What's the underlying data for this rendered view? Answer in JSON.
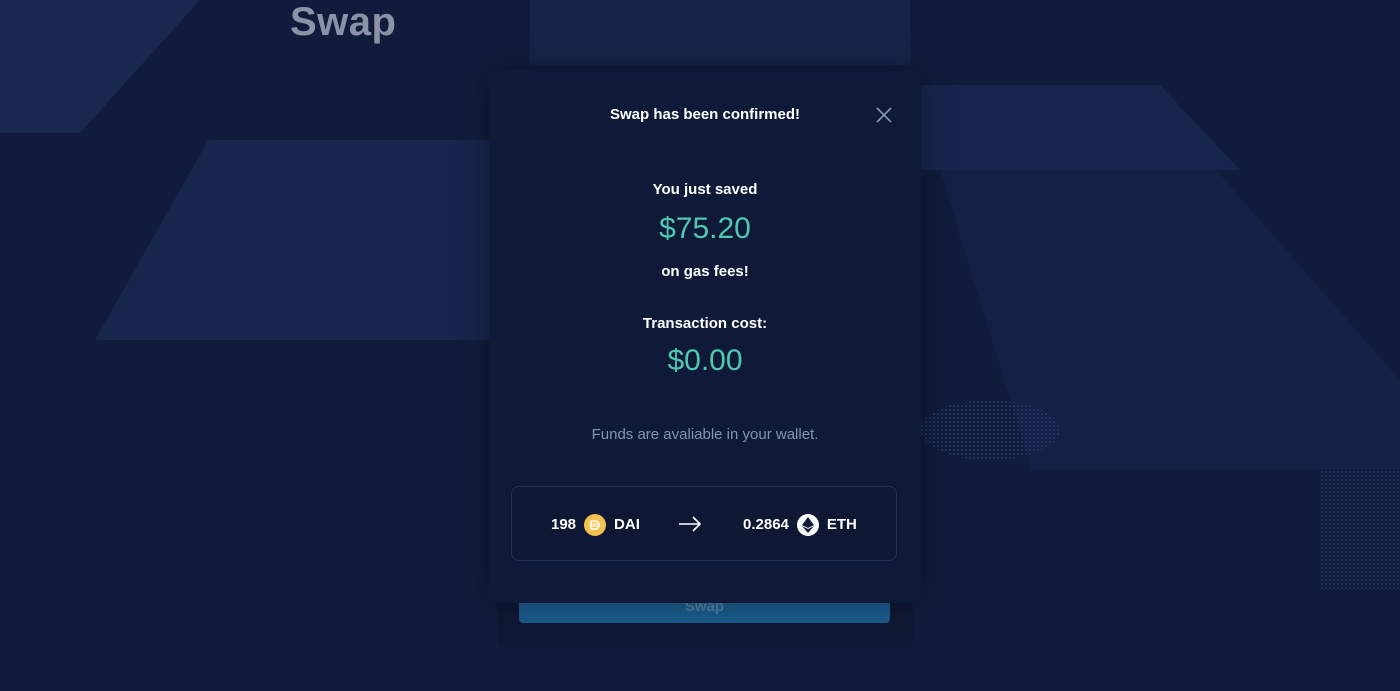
{
  "page": {
    "heading": "Swap"
  },
  "background_card": {
    "swap_button_label": "Swap"
  },
  "modal": {
    "title": "Swap has been confirmed!",
    "saved_label": "You just saved",
    "saved_amount": "$75.20",
    "gas_label": "on gas fees!",
    "cost_label": "Transaction cost:",
    "cost_amount": "$0.00",
    "funds_message": "Funds are avaliable in your wallet.",
    "summary": {
      "from_amount": "198",
      "from_token": "DAI",
      "from_icon": "dai-token-icon",
      "arrow_icon": "arrow-right-icon",
      "to_amount": "0.2864",
      "to_token": "ETH",
      "to_icon": "eth-token-icon"
    }
  },
  "colors": {
    "background": "#111c3c",
    "modal_bg": "#0f1a38",
    "accent": "#4ec9b0",
    "dai_yellow": "#f4c34f",
    "muted_text": "#7f97ad"
  }
}
